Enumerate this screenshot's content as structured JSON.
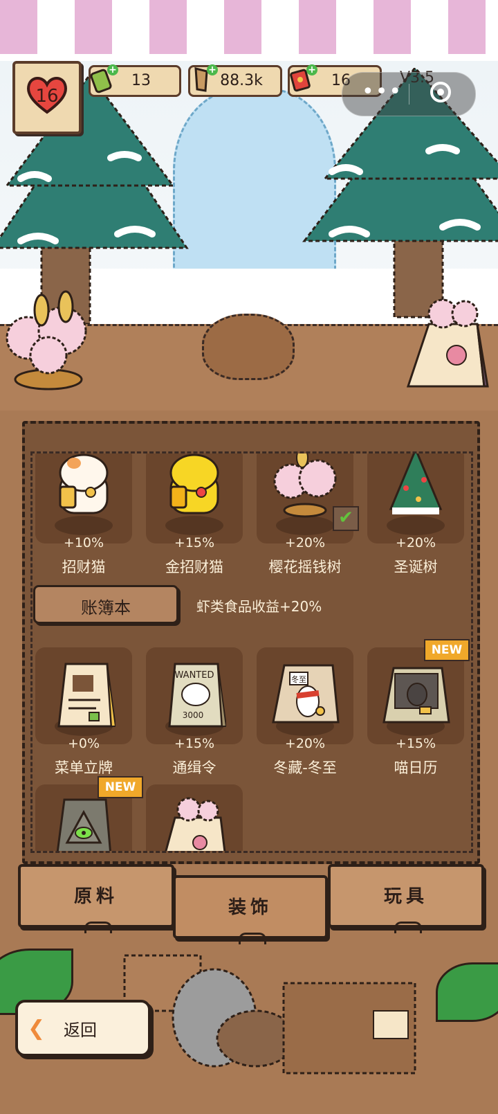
{
  "hud": {
    "hearts": "16",
    "resources": [
      {
        "icon": "fish-bait-icon",
        "value": "13"
      },
      {
        "icon": "dried-fish-icon",
        "value": "88.3k"
      },
      {
        "icon": "red-envelope-icon",
        "value": "16"
      }
    ],
    "version": "V3.5"
  },
  "decor_row": [
    {
      "name": "招财猫",
      "bonus": "+10%"
    },
    {
      "name": "金招财猫",
      "bonus": "+15%"
    },
    {
      "name": "樱花摇钱树",
      "bonus": "+20%",
      "equipped": true
    },
    {
      "name": "圣诞树",
      "bonus": "+20%"
    }
  ],
  "section": {
    "title": "账簿本",
    "description": "虾类食品收益+20%"
  },
  "ledger_row": [
    {
      "name": "菜单立牌",
      "bonus": "+0%"
    },
    {
      "name": "通缉令",
      "bonus": "+15%",
      "poster_title": "WANTED",
      "poster_price": "3000"
    },
    {
      "name": "冬藏-冬至",
      "bonus": "+20%",
      "card_text": "冬至"
    },
    {
      "name": "喵日历",
      "bonus": "+15%",
      "badge": "NEW"
    }
  ],
  "partial_row": [
    {
      "badge": "NEW"
    },
    {}
  ],
  "tabs": [
    {
      "label": "原料"
    },
    {
      "label": "装饰"
    },
    {
      "label": "玩具"
    }
  ],
  "back_label": "返回",
  "colors": {
    "awning_pink": "#e7b6d8",
    "panel_brown": "#7b5539",
    "text_cream": "#fbefd8",
    "new_badge": "#f0a82a",
    "back_arrow": "#ef8a3a"
  }
}
